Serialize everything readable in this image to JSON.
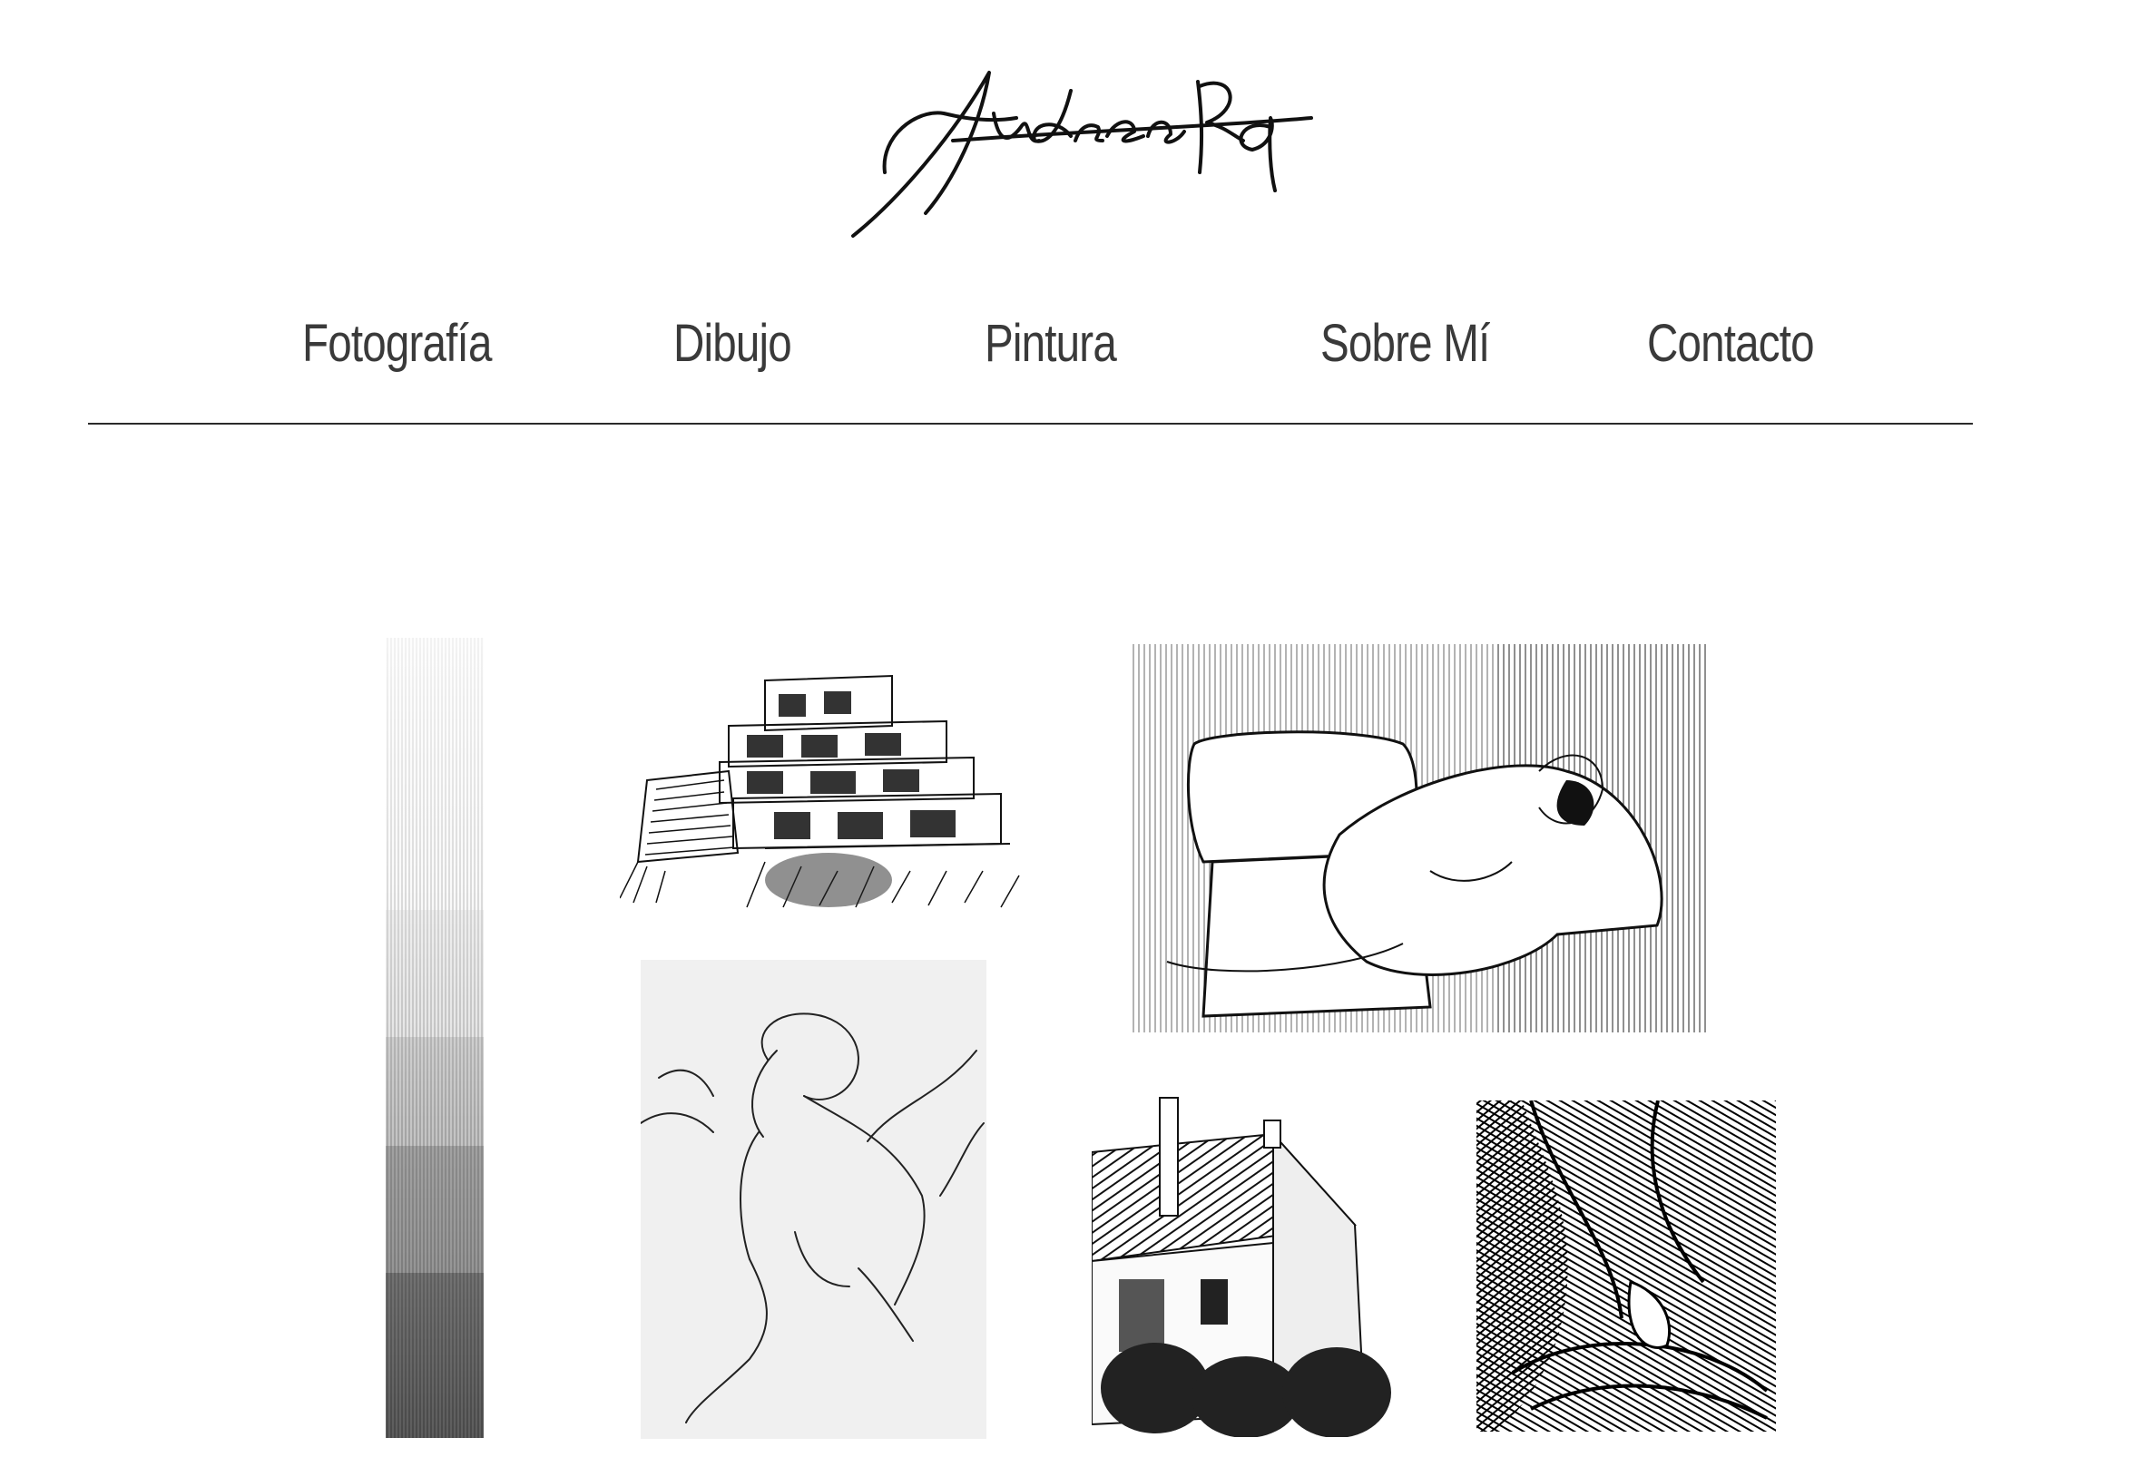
{
  "site": {
    "logo_text": "Andrea RG"
  },
  "nav": {
    "items": [
      {
        "label": "Fotografía"
      },
      {
        "label": "Dibujo"
      },
      {
        "label": "Pintura"
      },
      {
        "label": "Sobre Mí"
      },
      {
        "label": "Contacto"
      }
    ]
  },
  "gallery": {
    "items": [
      {
        "subject": "tonal-scale-strip"
      },
      {
        "subject": "terraced-building-sketch"
      },
      {
        "subject": "reclining-figure-sketch"
      },
      {
        "subject": "seated-woman-line-drawing"
      },
      {
        "subject": "house-with-chimney-sketch"
      },
      {
        "subject": "figure-hatched-ink-sketch"
      }
    ]
  },
  "colors": {
    "text": "#3a3a3a",
    "ink": "#1a1a1a",
    "background": "#ffffff"
  }
}
